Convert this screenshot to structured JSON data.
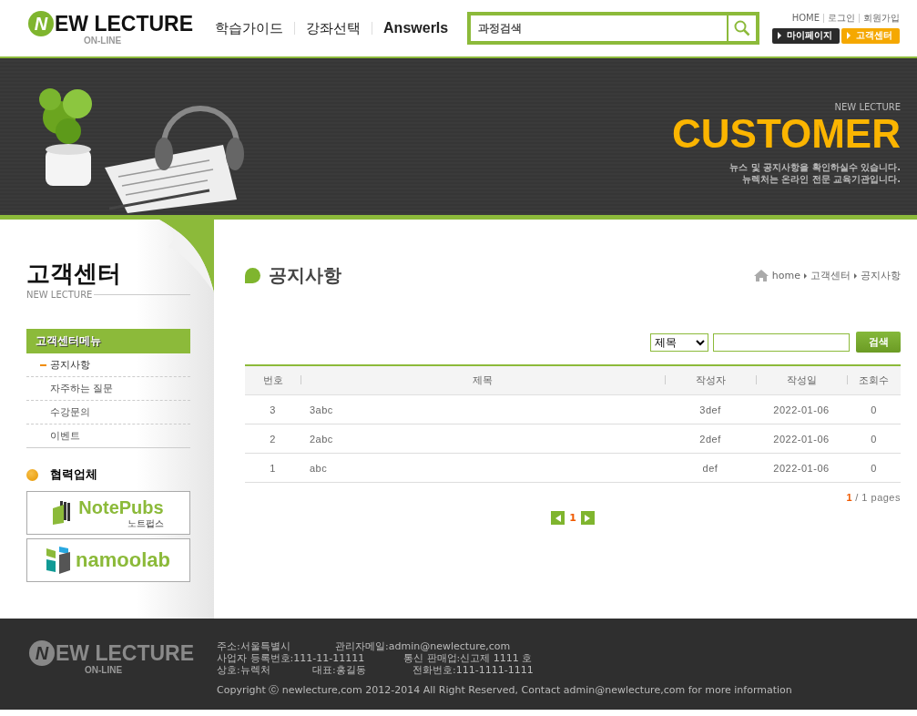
{
  "header": {
    "logo": {
      "letter": "N",
      "text": "EW LECTURE",
      "sub": "ON-LINE"
    },
    "nav": [
      "학습가이드",
      "강좌선택",
      "AnswerIs"
    ],
    "search": {
      "placeholder": "과정검색"
    },
    "top_links": [
      "HOME",
      "로그인",
      "회원가입"
    ],
    "quick_buttons": [
      {
        "label": "마이페이지",
        "kind": "dark"
      },
      {
        "label": "고객센터",
        "kind": "accent"
      }
    ]
  },
  "banner": {
    "eyebrow": "NEW LECTURE",
    "title": "CUSTOMER",
    "lines": [
      "뉴스 및 공지사항을 확인하실수 있습니다.",
      "뉴렉처는 온라인 전문 교육기관입니다."
    ]
  },
  "sidebar": {
    "title": "고객센터",
    "subtitle": "NEW LECTURE",
    "menu_title": "고객센터메뉴",
    "items": [
      {
        "label": "공지사항",
        "selected": true
      },
      {
        "label": "자주하는 질문",
        "selected": false
      },
      {
        "label": "수강문의",
        "selected": false
      },
      {
        "label": "이벤트",
        "selected": false
      }
    ],
    "partners_title": "협력업체",
    "partners": [
      {
        "kind": "notepubs",
        "name": "NotePubs",
        "sub": "노트펍스"
      },
      {
        "kind": "namoolab",
        "name": "namoolab"
      }
    ]
  },
  "content": {
    "title": "공지사항",
    "breadcrumb": [
      "home",
      "고객센터",
      "공지사항"
    ],
    "search": {
      "field": "제목",
      "button": "검색"
    },
    "table": {
      "columns": [
        "번호",
        "제목",
        "작성자",
        "작성일",
        "조회수"
      ],
      "rows": [
        [
          "3",
          "3abc",
          "3def",
          "2022-01-06",
          "0"
        ],
        [
          "2",
          "2abc",
          "2def",
          "2022-01-06",
          "0"
        ],
        [
          "1",
          "abc",
          "def",
          "2022-01-06",
          "0"
        ]
      ]
    },
    "page_info": {
      "current": "1",
      "rest": "/ 1 pages"
    },
    "pages": [
      {
        "label": "1",
        "selected": true
      }
    ]
  },
  "footer": {
    "logo": {
      "letter": "N",
      "text": "EW LECTURE",
      "sub": "ON-LINE"
    },
    "lines": [
      [
        "주소:서울특별시",
        "관리자메일:admin@newlecture,com"
      ],
      [
        "사업자 등록번호:111-11-11111",
        "통신 판매업:신고제 1111 호"
      ],
      [
        "상호:뉴렉처",
        "대표:홍길동",
        "전화번호:111-1111-1111"
      ]
    ],
    "copyright": "Copyright ⓒ newlecture,com 2012-2014 All Right Reserved, Contact admin@newlecture,com for more information"
  }
}
